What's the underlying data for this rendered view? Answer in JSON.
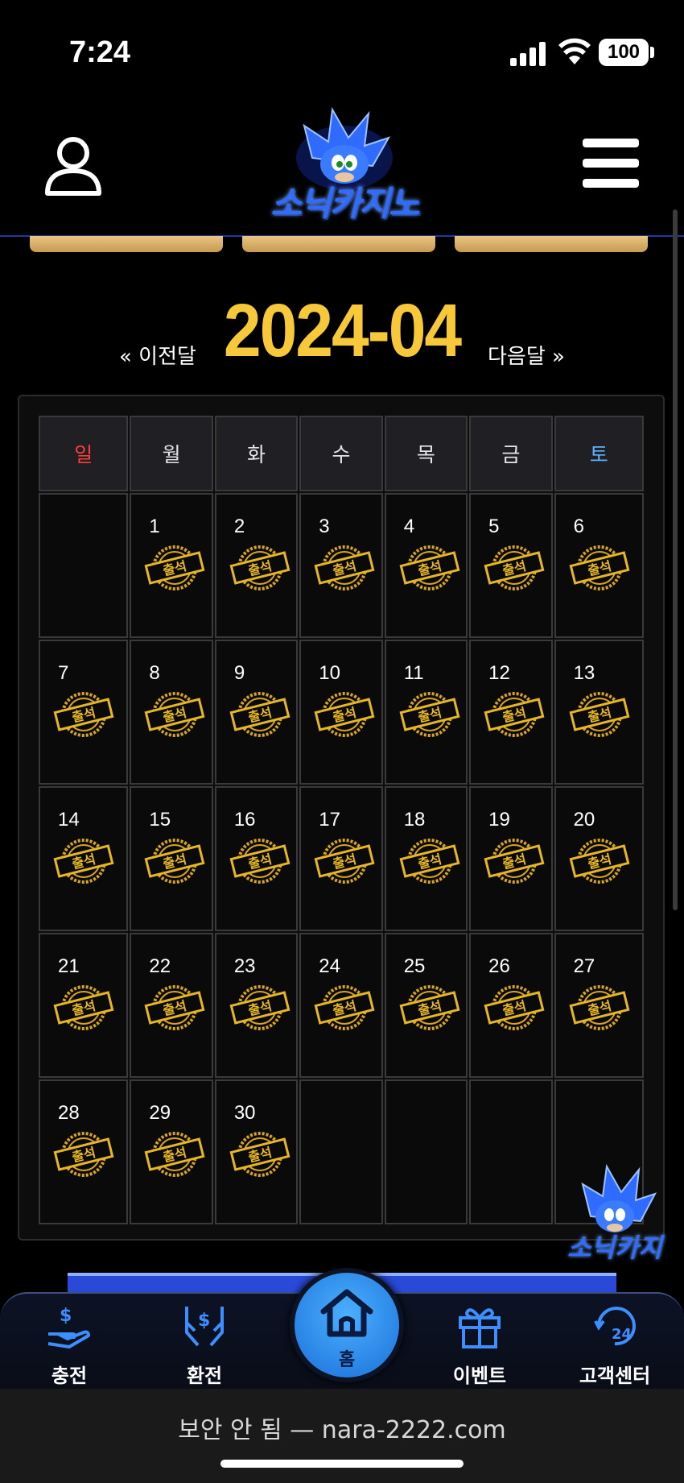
{
  "status_bar": {
    "time": "7:24",
    "battery": "100"
  },
  "header": {
    "logo_text": "소닉카지노"
  },
  "calendar": {
    "month": "2024-04",
    "prev_label": "« 이전달",
    "next_label": "다음달 »",
    "weekdays": [
      "일",
      "월",
      "화",
      "수",
      "목",
      "금",
      "토"
    ],
    "stamp_label": "출석",
    "weeks": [
      [
        "",
        "1",
        "2",
        "3",
        "4",
        "5",
        "6"
      ],
      [
        "7",
        "8",
        "9",
        "10",
        "11",
        "12",
        "13"
      ],
      [
        "14",
        "15",
        "16",
        "17",
        "18",
        "19",
        "20"
      ],
      [
        "21",
        "22",
        "23",
        "24",
        "25",
        "26",
        "27"
      ],
      [
        "28",
        "29",
        "30",
        "",
        "",
        "",
        ""
      ]
    ]
  },
  "mascot_text": "소닉카지",
  "bottom_nav": {
    "items": [
      {
        "label": "충전",
        "icon": "deposit-hand-icon"
      },
      {
        "label": "환전",
        "icon": "withdraw-hands-icon"
      },
      {
        "label": "홈",
        "icon": "home-icon"
      },
      {
        "label": "이벤트",
        "icon": "gift-icon"
      },
      {
        "label": "고객센터",
        "icon": "support-24-icon"
      }
    ]
  },
  "browser": {
    "url_text": "보안 안 됨 — nara-2222.com"
  },
  "colors": {
    "accent_gold": "#f7c93a",
    "sunday_red": "#ff3b3b",
    "saturday_blue": "#5fb0ff",
    "nav_blue": "#3d8fff"
  }
}
